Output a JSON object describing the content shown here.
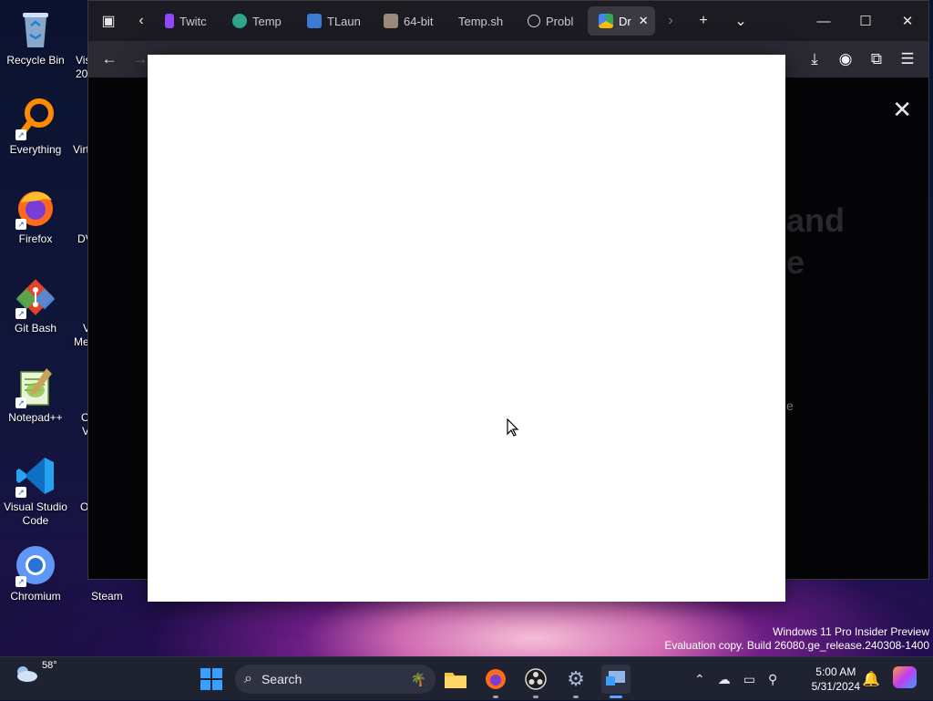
{
  "desktop": {
    "icons": [
      {
        "label": "Recycle Bin",
        "icon": "recycle-bin-icon"
      },
      {
        "label": "Everything",
        "icon": "everything-search-icon"
      },
      {
        "label": "Firefox",
        "icon": "firefox-icon"
      },
      {
        "label": "Git Bash",
        "icon": "git-bash-icon"
      },
      {
        "label": "Notepad++",
        "icon": "notepad-plus-plus-icon"
      },
      {
        "label": "Visual Studio Code",
        "icon": "vscode-icon"
      },
      {
        "label": "Chromium",
        "icon": "chromium-icon"
      }
    ],
    "partial_labels": [
      "Vis",
      "20",
      "Virt",
      "DV",
      "V",
      "Me",
      "O",
      "V",
      "O",
      "Steam"
    ]
  },
  "browser": {
    "tabs": [
      {
        "label": "Twitc",
        "icon": "twitch-icon"
      },
      {
        "label": "Temp",
        "icon": "globe-icon"
      },
      {
        "label": "TLaun",
        "icon": "tl-icon"
      },
      {
        "label": "64-bit",
        "icon": "document-icon"
      },
      {
        "label": "Temp.sh",
        "icon": ""
      },
      {
        "label": "Probl",
        "icon": "info-icon"
      },
      {
        "label": "Dr",
        "icon": "drive-icon",
        "active": true
      }
    ],
    "ghost": {
      "line1": "and",
      "line2": "e",
      "line3": "e"
    }
  },
  "watermark": {
    "line1": "Windows 11 Pro Insider Preview",
    "line2": "Evaluation copy. Build 26080.ge_release.240308-1400"
  },
  "taskbar": {
    "weather_temp": "58°",
    "search_label": "Search",
    "time": "5:00 AM",
    "date": "5/31/2024"
  },
  "colors": {
    "accent": "#0a84ff",
    "taskbar": "#1f2230",
    "window": "#1c1b22"
  }
}
